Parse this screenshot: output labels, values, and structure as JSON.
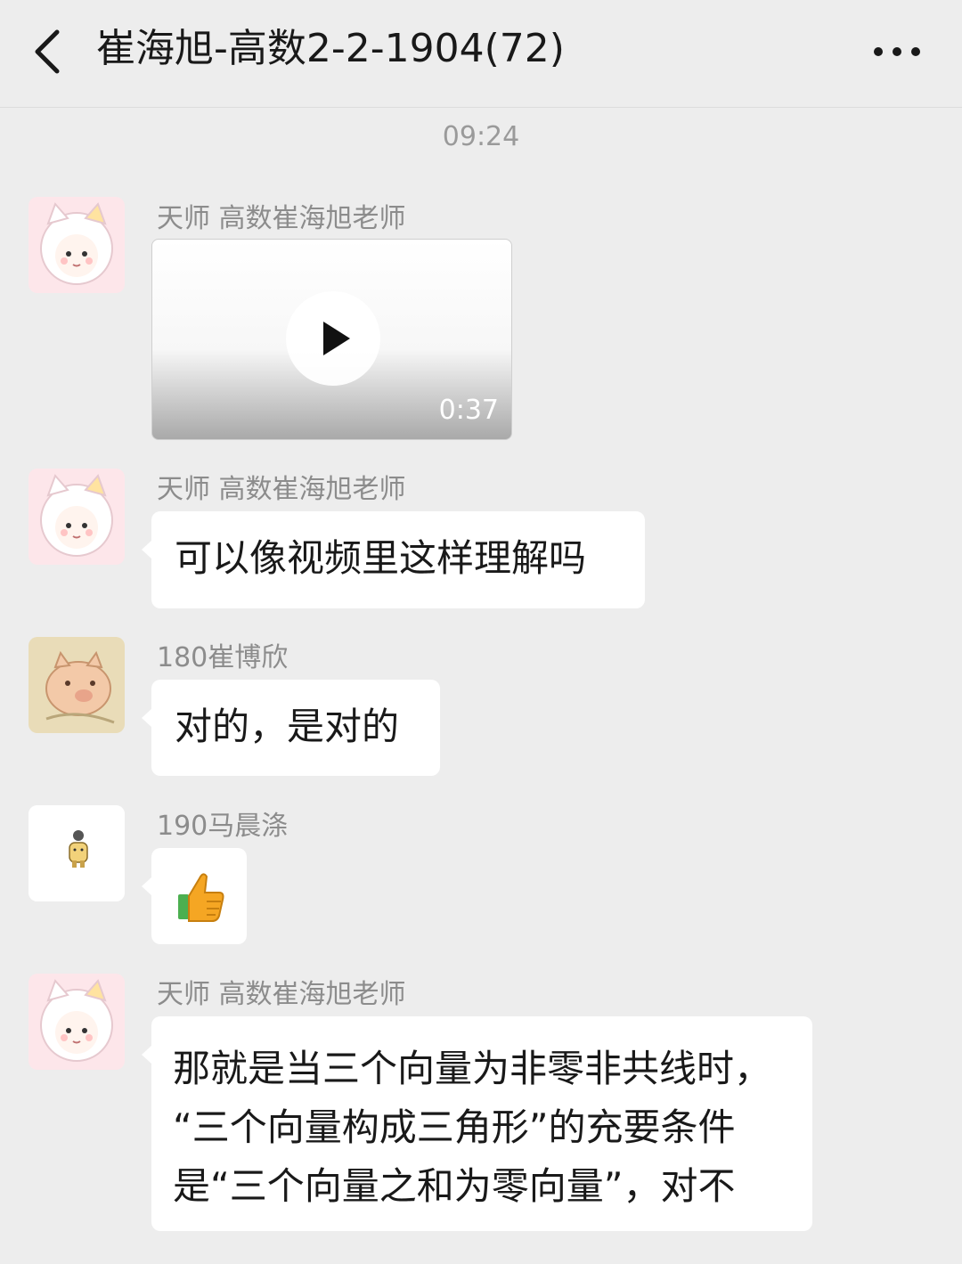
{
  "header": {
    "title": "崔海旭-高数2-2-1904(72)",
    "back_icon": "chevron-left-icon",
    "more_icon": "more-dots-icon"
  },
  "chat": {
    "timestamp": "09:24",
    "messages": [
      {
        "sender": "天师 高数崔海旭老师",
        "type": "video",
        "duration": "0:37",
        "play_icon": "play-icon"
      },
      {
        "sender": "天师 高数崔海旭老师",
        "type": "text",
        "text": "可以像视频里这样理解吗"
      },
      {
        "sender": "180崔博欣",
        "type": "text",
        "text": "对的，是对的"
      },
      {
        "sender": "190马晨涤",
        "type": "emoji",
        "emoji_icon": "thumbs-up-icon"
      },
      {
        "sender": "天师 高数崔海旭老师",
        "type": "text",
        "lines": [
          "那就是当三个向量为非零非共线时，",
          "“三个向量构成三角形”的充要条件",
          "是“三个向量之和为零向量”，对不"
        ]
      }
    ]
  },
  "colors": {
    "background": "#ededed",
    "bubble": "#ffffff",
    "text": "#191919",
    "secondary_text": "#8c8c8c",
    "thumbs_up_hand": "#f5a623",
    "thumbs_up_cuff": "#4caf50"
  }
}
